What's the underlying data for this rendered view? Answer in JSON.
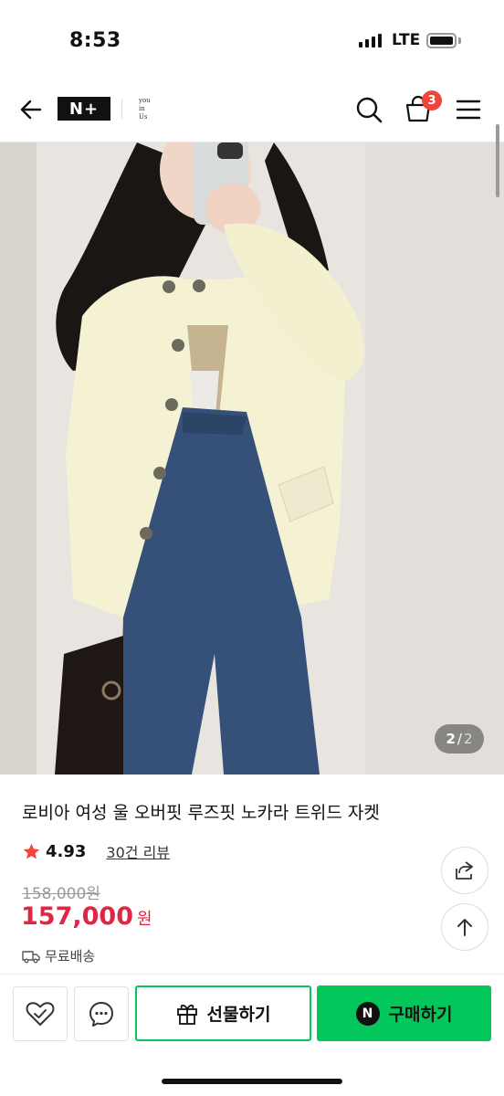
{
  "status_bar": {
    "time": "8:53",
    "network": "LTE"
  },
  "header": {
    "logo_text": "N+",
    "sublogo_lines": [
      "you",
      "in",
      "Us"
    ],
    "cart_count": "3",
    "icons": [
      "back-arrow-icon",
      "search-icon",
      "cart-icon",
      "menu-icon"
    ]
  },
  "gallery": {
    "current": "2",
    "separator": "/",
    "total": "2"
  },
  "product": {
    "title": "로비아 여성 울 오버핏 루즈핏 노카라 트위드 자켓",
    "rating": "4.93",
    "review_link": "30건 리뷰",
    "original_price": "158,000원",
    "price": "157,000",
    "currency": "원",
    "shipping": "무료배송"
  },
  "bottom_bar": {
    "gift_label": "선물하기",
    "buy_label": "구매하기",
    "buy_badge": "N"
  },
  "colors": {
    "accent_green": "#03c75a",
    "price_red": "#e02644",
    "star": "#f0453a",
    "badge": "#f0453a"
  }
}
